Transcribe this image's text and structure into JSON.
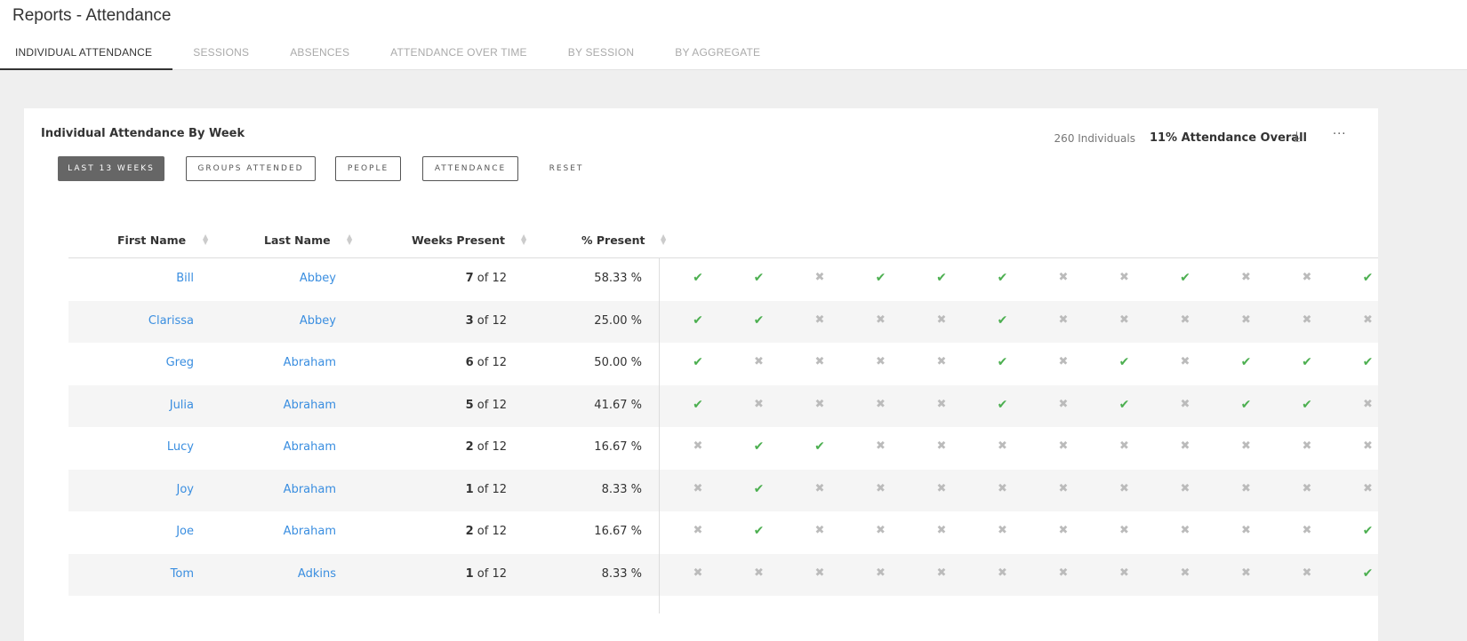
{
  "header": {
    "title": "Reports - Attendance"
  },
  "tabs": [
    {
      "label": "INDIVIDUAL ATTENDANCE",
      "active": true
    },
    {
      "label": "SESSIONS"
    },
    {
      "label": "ABSENCES"
    },
    {
      "label": "ATTENDANCE OVER TIME"
    },
    {
      "label": "BY SESSION"
    },
    {
      "label": "BY AGGREGATE"
    }
  ],
  "card": {
    "title": "Individual Attendance By Week",
    "individuals": "260 Individuals",
    "overall": "11% Attendance Overall",
    "download_icon": "download-icon",
    "more_icon": "ellipsis-icon"
  },
  "filters": {
    "last13": "LAST 13 WEEKS",
    "groups": "GROUPS ATTENDED",
    "people": "PEOPLE",
    "attendance": "ATTENDANCE",
    "reset": "RESET"
  },
  "columns": {
    "first": "First Name",
    "last": "Last Name",
    "weeks": "Weeks Present",
    "pct": "% Present"
  },
  "colors": {
    "present": "#4caf50",
    "absent": "#bbbbbb",
    "link": "#3a8ee0"
  },
  "rows": [
    {
      "first": "Bill",
      "last": "Abbey",
      "weeks": "7",
      "of": "of 12",
      "pct": "58.33 %",
      "att": [
        1,
        1,
        0,
        1,
        1,
        1,
        0,
        0,
        1,
        0,
        0,
        1
      ]
    },
    {
      "first": "Clarissa",
      "last": "Abbey",
      "weeks": "3",
      "of": "of 12",
      "pct": "25.00 %",
      "att": [
        1,
        1,
        0,
        0,
        0,
        1,
        0,
        0,
        0,
        0,
        0,
        0
      ]
    },
    {
      "first": "Greg",
      "last": "Abraham",
      "weeks": "6",
      "of": "of 12",
      "pct": "50.00 %",
      "att": [
        1,
        0,
        0,
        0,
        0,
        1,
        0,
        1,
        0,
        1,
        1,
        1
      ]
    },
    {
      "first": "Julia",
      "last": "Abraham",
      "weeks": "5",
      "of": "of 12",
      "pct": "41.67 %",
      "att": [
        1,
        0,
        0,
        0,
        0,
        1,
        0,
        1,
        0,
        1,
        1,
        0
      ]
    },
    {
      "first": "Lucy",
      "last": "Abraham",
      "weeks": "2",
      "of": "of 12",
      "pct": "16.67 %",
      "att": [
        0,
        1,
        1,
        0,
        0,
        0,
        0,
        0,
        0,
        0,
        0,
        0
      ]
    },
    {
      "first": "Joy",
      "last": "Abraham",
      "weeks": "1",
      "of": "of 12",
      "pct": "8.33 %",
      "att": [
        0,
        1,
        0,
        0,
        0,
        0,
        0,
        0,
        0,
        0,
        0,
        0
      ]
    },
    {
      "first": "Joe",
      "last": "Abraham",
      "weeks": "2",
      "of": "of 12",
      "pct": "16.67 %",
      "att": [
        0,
        1,
        0,
        0,
        0,
        0,
        0,
        0,
        0,
        0,
        0,
        1
      ]
    },
    {
      "first": "Tom",
      "last": "Adkins",
      "weeks": "1",
      "of": "of 12",
      "pct": "8.33 %",
      "att": [
        0,
        0,
        0,
        0,
        0,
        0,
        0,
        0,
        0,
        0,
        0,
        1
      ]
    }
  ]
}
